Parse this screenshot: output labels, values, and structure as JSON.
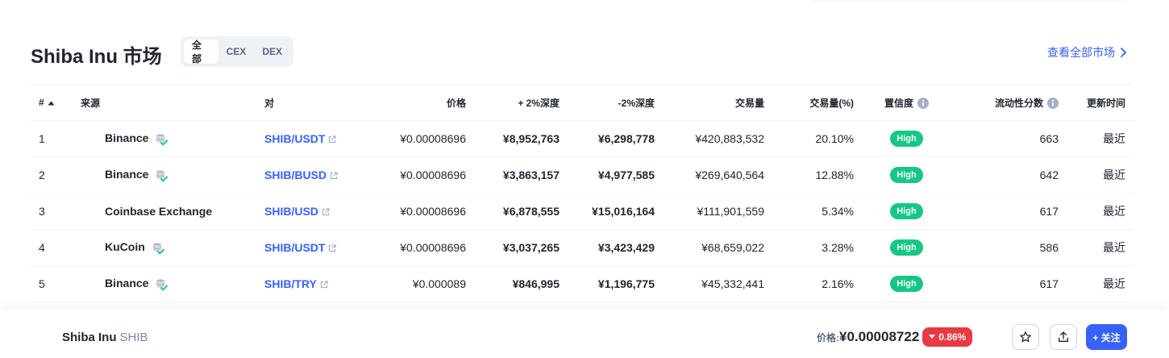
{
  "header": {
    "title": "Shiba Inu 市场",
    "tabs": [
      {
        "label": "全部",
        "active": true
      },
      {
        "label": "CEX",
        "active": false
      },
      {
        "label": "DEX",
        "active": false
      }
    ],
    "view_all_label": "查看全部市场"
  },
  "table": {
    "columns": {
      "rank": "#",
      "source": "来源",
      "pair": "对",
      "price": "价格",
      "depth_plus": "+ 2%深度",
      "depth_minus": "-2%深度",
      "volume": "交易量",
      "volume_pct": "交易量(%)",
      "confidence": "置信度",
      "liquidity": "流动性分数",
      "updated": "更新时间"
    },
    "rows": [
      {
        "rank": "1",
        "exchange": "Binance",
        "has_db_icon": true,
        "pair": "SHIB/USDT",
        "price": "¥0.00008696",
        "depth_plus": "¥8,952,763",
        "depth_minus": "¥6,298,778",
        "volume": "¥420,883,532",
        "volume_pct": "20.10%",
        "confidence": "High",
        "liquidity": "663",
        "updated": "最近"
      },
      {
        "rank": "2",
        "exchange": "Binance",
        "has_db_icon": true,
        "pair": "SHIB/BUSD",
        "price": "¥0.00008696",
        "depth_plus": "¥3,863,157",
        "depth_minus": "¥4,977,585",
        "volume": "¥269,640,564",
        "volume_pct": "12.88%",
        "confidence": "High",
        "liquidity": "642",
        "updated": "最近"
      },
      {
        "rank": "3",
        "exchange": "Coinbase Exchange",
        "has_db_icon": false,
        "pair": "SHIB/USD",
        "price": "¥0.00008696",
        "depth_plus": "¥6,878,555",
        "depth_minus": "¥15,016,164",
        "volume": "¥111,901,559",
        "volume_pct": "5.34%",
        "confidence": "High",
        "liquidity": "617",
        "updated": "最近"
      },
      {
        "rank": "4",
        "exchange": "KuCoin",
        "has_db_icon": true,
        "pair": "SHIB/USDT",
        "price": "¥0.00008696",
        "depth_plus": "¥3,037,265",
        "depth_minus": "¥3,423,429",
        "volume": "¥68,659,022",
        "volume_pct": "3.28%",
        "confidence": "High",
        "liquidity": "586",
        "updated": "最近"
      },
      {
        "rank": "5",
        "exchange": "Binance",
        "has_db_icon": true,
        "pair": "SHIB/TRY",
        "price": "¥0.000089",
        "depth_plus": "¥846,995",
        "depth_minus": "¥1,196,775",
        "volume": "¥45,332,441",
        "volume_pct": "2.16%",
        "confidence": "High",
        "liquidity": "617",
        "updated": "最近"
      }
    ]
  },
  "bottom_bar": {
    "coin_name": "Shiba Inu",
    "coin_symbol": "SHIB",
    "price_label": "价格:",
    "price_value": "¥0.00008722",
    "change": "0.86%",
    "follow_label": "+ 关注"
  },
  "colors": {
    "accent": "#3861fb",
    "high_badge": "#16c784",
    "negative": "#ea3943",
    "text_primary": "#222531",
    "text_secondary": "#58667e"
  },
  "icons": {
    "sort": "sort-up-icon",
    "info": "info-icon",
    "external": "external-link-icon",
    "exchange_db": "database-check-icon",
    "star": "star-icon",
    "share": "share-icon",
    "chevron": "chevron-right-icon"
  }
}
